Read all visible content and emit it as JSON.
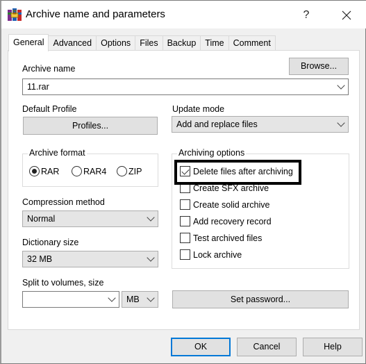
{
  "window": {
    "title": "Archive name and parameters",
    "help_label": "?",
    "close_icon": "close-icon",
    "app_icon": "winrar-books-icon"
  },
  "tabs": [
    {
      "label": "General",
      "active": true
    },
    {
      "label": "Advanced",
      "active": false
    },
    {
      "label": "Options",
      "active": false
    },
    {
      "label": "Files",
      "active": false
    },
    {
      "label": "Backup",
      "active": false
    },
    {
      "label": "Time",
      "active": false
    },
    {
      "label": "Comment",
      "active": false
    }
  ],
  "general": {
    "archive_name_label": "Archive name",
    "archive_name_value": "11.rar",
    "browse_label": "Browse...",
    "default_profile_label": "Default Profile",
    "profiles_label": "Profiles...",
    "update_mode_label": "Update mode",
    "update_mode_value": "Add and replace files",
    "archive_format": {
      "title": "Archive format",
      "options": [
        {
          "label": "RAR",
          "selected": true
        },
        {
          "label": "RAR4",
          "selected": false
        },
        {
          "label": "ZIP",
          "selected": false
        }
      ]
    },
    "compression_method_label": "Compression method",
    "compression_method_value": "Normal",
    "dictionary_size_label": "Dictionary size",
    "dictionary_size_value": "32 MB",
    "split_label": "Split to volumes, size",
    "split_value": "",
    "split_unit_value": "MB",
    "archiving_options": {
      "title": "Archiving options",
      "items": [
        {
          "label": "Delete files after archiving",
          "checked": true
        },
        {
          "label": "Create SFX archive",
          "checked": false
        },
        {
          "label": "Create solid archive",
          "checked": false
        },
        {
          "label": "Add recovery record",
          "checked": false
        },
        {
          "label": "Test archived files",
          "checked": false
        },
        {
          "label": "Lock archive",
          "checked": false
        }
      ]
    },
    "set_password_label": "Set password..."
  },
  "footer": {
    "ok_label": "OK",
    "cancel_label": "Cancel",
    "help_label": "Help"
  },
  "colors": {
    "default_button_border": "#0078d7",
    "highlight_box": "#000000"
  }
}
